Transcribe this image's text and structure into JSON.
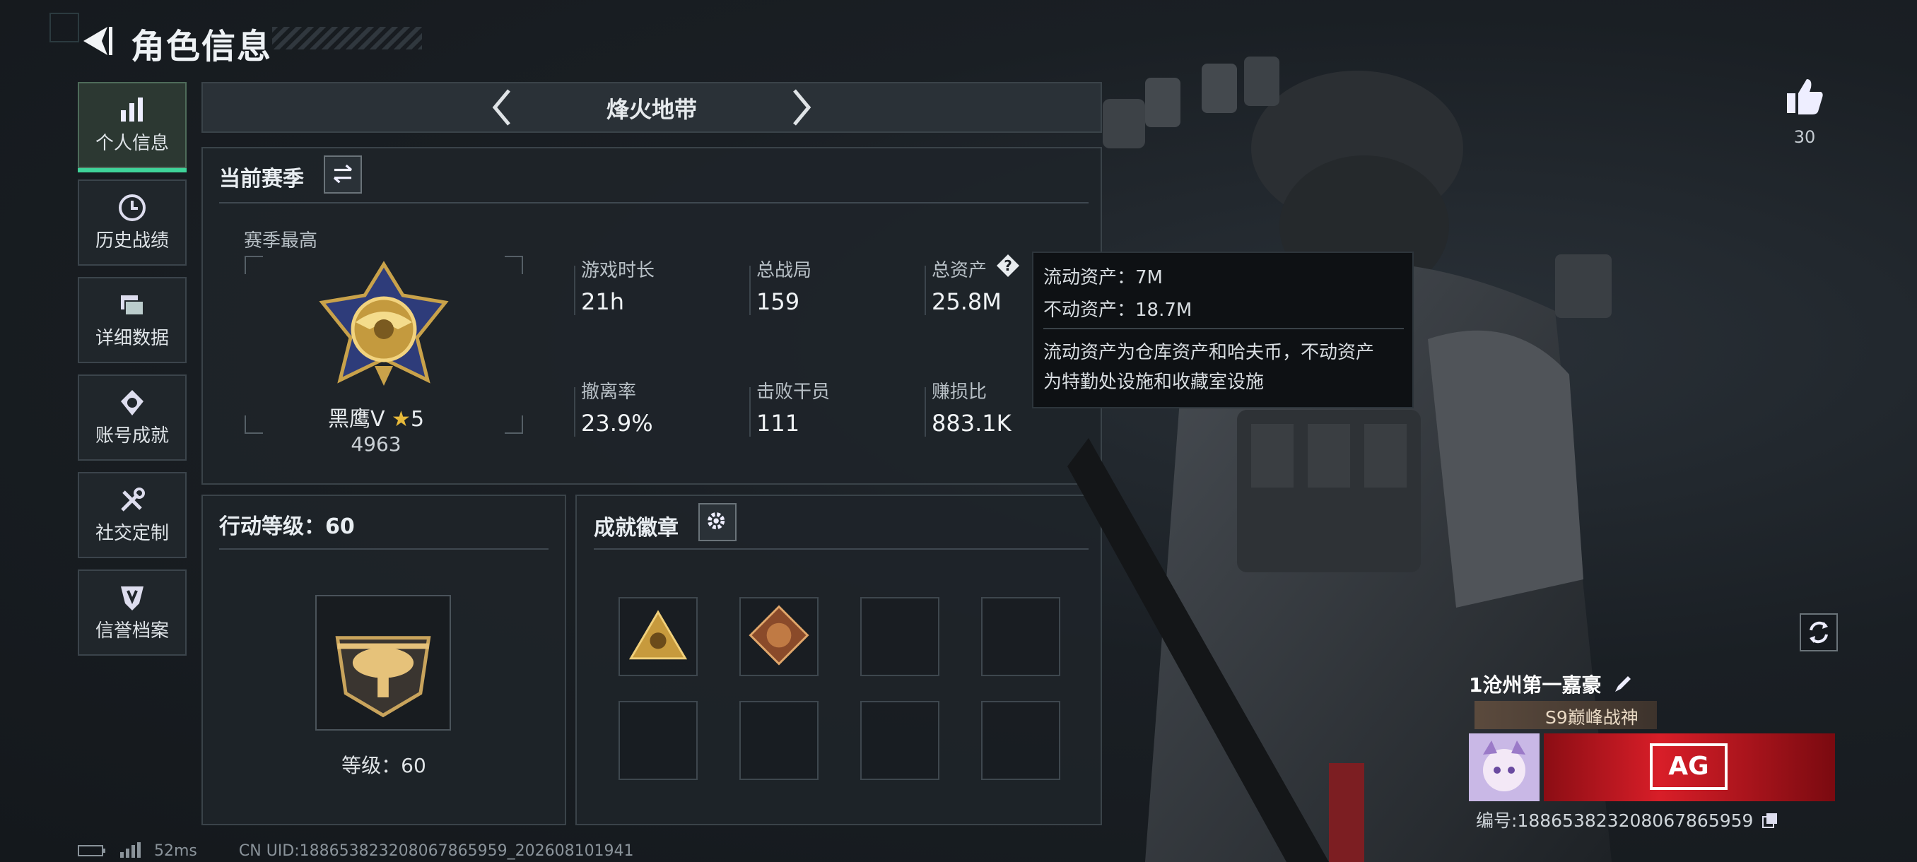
{
  "header": {
    "title": "角色信息"
  },
  "nav": [
    {
      "label": "个人信息",
      "icon": "bar-chart-icon",
      "active": true
    },
    {
      "label": "历史战绩",
      "icon": "clock-icon"
    },
    {
      "label": "详细数据",
      "icon": "folder-icon"
    },
    {
      "label": "账号成就",
      "icon": "medal-icon"
    },
    {
      "label": "社交定制",
      "icon": "tools-icon"
    },
    {
      "label": "信誉档案",
      "icon": "shield-icon"
    }
  ],
  "mode": {
    "name": "烽火地带"
  },
  "season": {
    "title": "当前赛季",
    "best_label": "赛季最高",
    "rank_name": "黑鹰Ⅴ",
    "rank_stars": "5",
    "rank_score": "4963",
    "stats": [
      {
        "label": "游戏时长",
        "value": "21h"
      },
      {
        "label": "总战局",
        "value": "159"
      },
      {
        "label": "总资产",
        "value": "25.8M"
      },
      {
        "label": "撤离率",
        "value": "23.9%"
      },
      {
        "label": "击败干员",
        "value": "111"
      },
      {
        "label": "赚损比",
        "value": "883.1K"
      }
    ]
  },
  "tooltip": {
    "liquid": "流动资产：7M",
    "fixed": "不动资产：18.7M",
    "desc1": "流动资产为仓库资产和哈夫币，不动资产",
    "desc2": "为特勤处设施和收藏室设施"
  },
  "level": {
    "title": "行动等级：60",
    "label": "等级：60"
  },
  "badges": {
    "title": "成就徽章"
  },
  "likes": {
    "count": "30"
  },
  "profile": {
    "name": "1沧州第一嘉豪",
    "rank_tag": "S9巅峰战神",
    "uid": "编号:18865382320806786595​9",
    "banner_text": "AG"
  },
  "status": {
    "ping": "52ms",
    "uid": "CN UID:18865382320806786595​9_202608101941"
  }
}
